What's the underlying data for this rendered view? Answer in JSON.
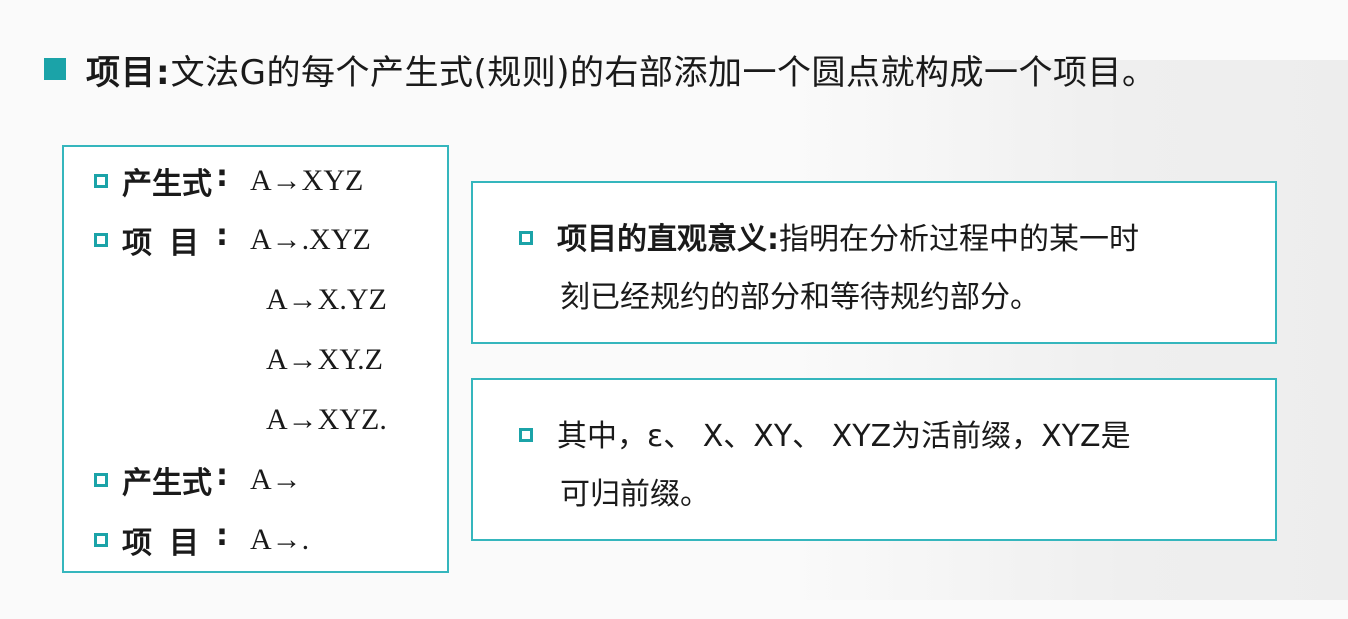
{
  "title": {
    "bold": "项目:",
    "rest": "文法G的每个产生式(规则)的右部添加一个圆点就构成一个项目。"
  },
  "left_box": {
    "rows": [
      {
        "label_a": "产生式",
        "label_b": "",
        "colon": ":",
        "value": "A→XYZ"
      },
      {
        "label_a": "项",
        "label_b": "目",
        "colon": ":",
        "value": "A→.XYZ"
      }
    ],
    "items": [
      "A→X.YZ",
      "A→XY.Z",
      "A→XYZ."
    ],
    "rows2": [
      {
        "label_a": "产生式",
        "label_b": "",
        "colon": ":",
        "value": "A→"
      },
      {
        "label_a": "项",
        "label_b": "目",
        "colon": ":",
        "value": "A→."
      }
    ]
  },
  "box1": {
    "bold": "项目的直观意义:",
    "line1_rest": "指明在分析过程中的某一时",
    "line2": "刻已经规约的部分和等待规约部分。"
  },
  "box2": {
    "line1": "其中，ε、 X、XY、 XYZ为活前缀，XYZ是",
    "line2": "可归前缀。"
  },
  "colors": {
    "accent": "#1ba3a8",
    "border": "#35b6bd"
  }
}
